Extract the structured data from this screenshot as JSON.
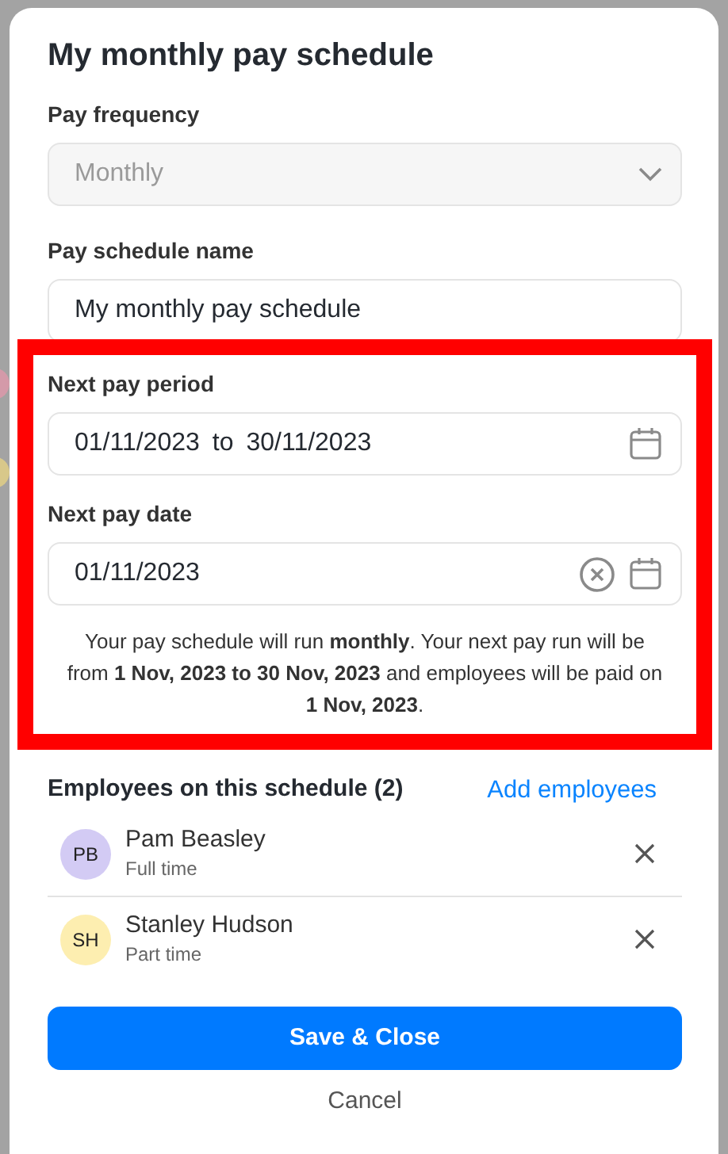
{
  "dialog": {
    "title": "My monthly pay schedule"
  },
  "fields": [
    {
      "kind": "select",
      "label": "Pay frequency",
      "value": "Monthly",
      "disabled": true
    },
    {
      "kind": "text",
      "label": "Pay schedule name",
      "value": "My monthly pay schedule"
    }
  ],
  "highlighted_section": {
    "fields": [
      {
        "kind": "range",
        "label": "Next pay period",
        "value": "01/11/2023",
        "separator": "to",
        "end_value": "30/11/2023"
      },
      {
        "kind": "date",
        "label": "Next pay date",
        "value": "01/11/2023",
        "clearable": true
      }
    ],
    "summary": "Your pay schedule will run **monthly**. Your next pay run will be from **1 Nov, 2023 to 30 Nov, 2023** and employees will be paid on **1 Nov, 2023**."
  },
  "employees": {
    "title": "Employees on this schedule (2)",
    "add_link": "Add employees",
    "items": [
      {
        "initials": "PB",
        "name": "Pam Beasley",
        "type": "Full time",
        "color": "#d3cbf4"
      },
      {
        "initials": "SH",
        "name": "Stanley Hudson",
        "type": "Part time",
        "color": "#fdeeb0"
      }
    ]
  },
  "buttons": {
    "primary": "Save & Close",
    "secondary": "Cancel"
  }
}
